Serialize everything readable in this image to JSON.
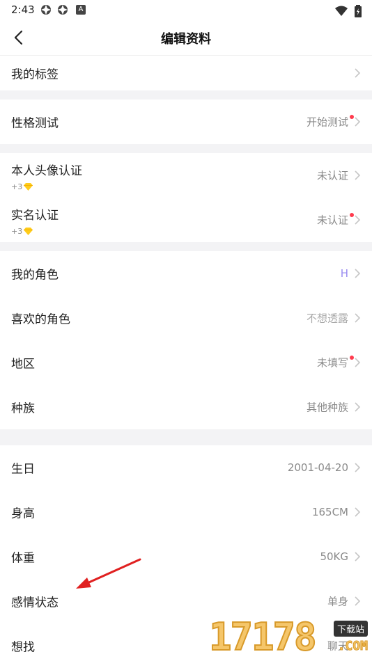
{
  "status": {
    "time": "2:43",
    "badge": "A"
  },
  "header": {
    "title": "编辑资料"
  },
  "sections": {
    "tags": {
      "label": "我的标签"
    },
    "personality": {
      "label": "性格测试",
      "value": "开始测试"
    },
    "avatar_verify": {
      "label": "本人头像认证",
      "reward": "+3",
      "value": "未认证"
    },
    "realname_verify": {
      "label": "实名认证",
      "reward": "+3",
      "value": "未认证"
    },
    "my_role": {
      "label": "我的角色",
      "value": "H"
    },
    "liked_role": {
      "label": "喜欢的角色",
      "value": "不想透露"
    },
    "region": {
      "label": "地区",
      "value": "未填写"
    },
    "race": {
      "label": "种族",
      "value": "其他种族"
    },
    "birthday": {
      "label": "生日",
      "value": "2001-04-20"
    },
    "height": {
      "label": "身高",
      "value": "165CM"
    },
    "weight": {
      "label": "体重",
      "value": "50KG"
    },
    "relationship": {
      "label": "感情状态",
      "value": "单身"
    },
    "looking_for": {
      "label": "想找",
      "value": "聊天"
    }
  },
  "watermark": {
    "number": "17178",
    "tag": "下载站",
    "domain": ".COM"
  },
  "colors": {
    "accent": "#9a8cf0",
    "dot": "#ff3b4e",
    "divider": "#f3f3f5",
    "arrow": "#e02020"
  }
}
